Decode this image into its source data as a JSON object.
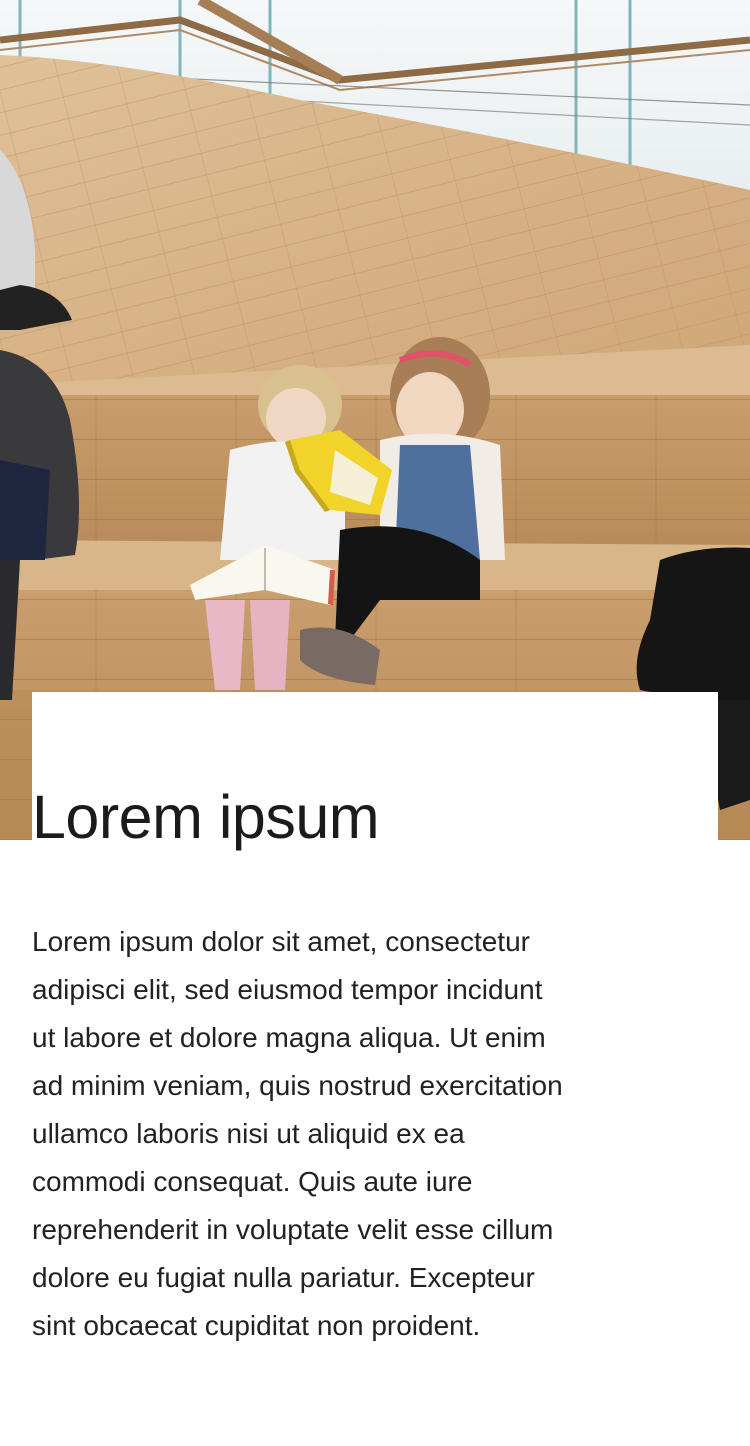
{
  "hero": {
    "image_description_icon": "photo-library-reading-steps"
  },
  "article": {
    "title": "Lorem ipsum",
    "body_lines": [
      "Lorem ipsum dolor sit amet, consectetur",
      "adipisci elit, sed eiusmod tempor incidunt",
      "ut labore et dolore magna aliqua. Ut enim",
      "ad minim veniam, quis nostrud exercitation",
      "ullamco laboris nisi ut aliquid ex ea",
      "commodi consequat. Quis aute iure",
      "reprehenderit in voluptate velit esse cillum",
      "dolore eu fugiat nulla pariatur. Excepteur",
      "sint obcaecat cupiditat non proident."
    ]
  },
  "colors": {
    "wood_light": "#dcbb92",
    "wood_mid": "#c99e6c",
    "wood_dark": "#a77a4d",
    "card_bg": "#ffffff",
    "text": "#1e1e1e"
  }
}
